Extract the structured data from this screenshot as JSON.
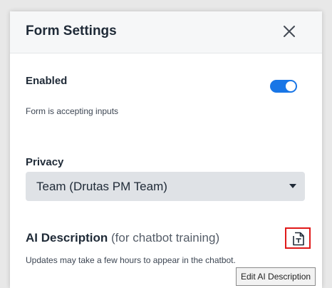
{
  "dialog": {
    "title": "Form Settings",
    "close_icon": "close-icon"
  },
  "enabled": {
    "label": "Enabled",
    "description": "Form is accepting inputs",
    "toggle_on": true,
    "toggle_color": "#1976e6"
  },
  "privacy": {
    "label": "Privacy",
    "selected": "Team (Drutas PM Team)",
    "caret_icon": "caret-down-icon"
  },
  "ai_description": {
    "label": "AI Description",
    "note": "(for chatbot training)",
    "help": "Updates may take a few hours to appear in the chatbot.",
    "edit_icon": "edit-document-icon",
    "highlight_color": "#e01919"
  },
  "tooltip": {
    "text": "Edit AI Description"
  }
}
